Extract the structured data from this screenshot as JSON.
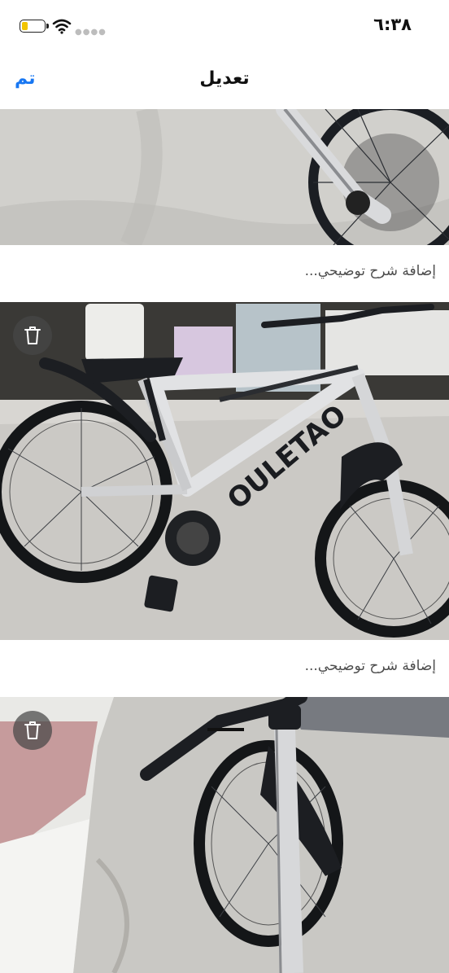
{
  "status_bar": {
    "time": "٦:٣٨",
    "battery_level": 0.3
  },
  "nav": {
    "title": "تعديل",
    "done_label": "تم"
  },
  "photos": [
    {
      "caption_placeholder": "إضافة شرح توضيحي...",
      "has_delete": false
    },
    {
      "caption_placeholder": "إضافة شرح توضيحي...",
      "has_delete": true,
      "visible_text": "OULETAO"
    },
    {
      "caption_placeholder": "",
      "has_delete": true
    }
  ],
  "icons": {
    "battery": "battery-icon",
    "wifi": "wifi-icon",
    "delete": "trash-icon"
  },
  "colors": {
    "accent": "#1877f2",
    "battery_fill": "#f2c400"
  }
}
